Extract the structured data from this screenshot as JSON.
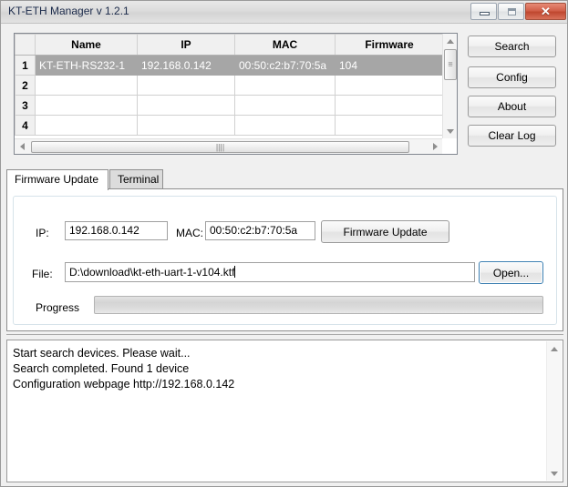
{
  "window": {
    "title": "KT-ETH Manager v 1.2.1",
    "controls": {
      "minimize_label": "",
      "maximize_label": "",
      "close_label": "✕"
    }
  },
  "device_table": {
    "columns": [
      "",
      "Name",
      "IP",
      "MAC",
      "Firmware"
    ],
    "rows": [
      {
        "num": "1",
        "name": "KT-ETH-RS232-1",
        "ip": "192.168.0.142",
        "mac": "00:50:c2:b7:70:5a",
        "firmware": "104",
        "selected": true
      },
      {
        "num": "2",
        "name": "",
        "ip": "",
        "mac": "",
        "firmware": "",
        "selected": false
      },
      {
        "num": "3",
        "name": "",
        "ip": "",
        "mac": "",
        "firmware": "",
        "selected": false
      },
      {
        "num": "4",
        "name": "",
        "ip": "",
        "mac": "",
        "firmware": "",
        "selected": false
      }
    ],
    "scroll_grip": "≡",
    "hscroll_grip": "||||"
  },
  "side_buttons": {
    "search": "Search",
    "config": "Config",
    "about": "About",
    "clear_log": "Clear Log"
  },
  "tabs": [
    {
      "label": "Firmware Update",
      "active": true
    },
    {
      "label": "Terminal",
      "active": false
    }
  ],
  "firmware_panel": {
    "ip_label": "IP:",
    "ip_value": "192.168.0.142",
    "mac_label": "MAC:",
    "mac_value": "00:50:c2:b7:70:5a",
    "update_button": "Firmware Update",
    "file_label": "File:",
    "file_value": "D:\\download\\kt-eth-uart-1-v104.ktf",
    "open_button": "Open...",
    "progress_label": "Progress",
    "progress_percent": 0
  },
  "log": {
    "lines": "Start search devices. Please wait...\nSearch completed. Found 1 device\nConfiguration webpage http://192.168.0.142"
  },
  "colors": {
    "selection": "#a6a6a6",
    "close_button": "#cc4f34",
    "focus_border": "#3c7fb1"
  }
}
